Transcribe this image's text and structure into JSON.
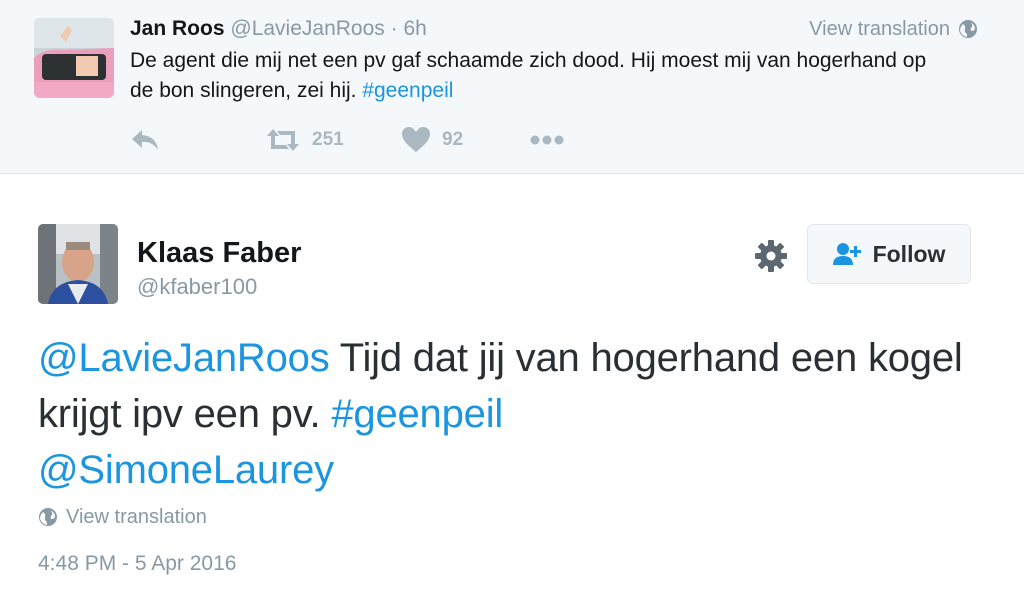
{
  "reply_tweet": {
    "name": "Jan Roos",
    "handle": "@LavieJanRoos",
    "separator": "·",
    "time": "6h",
    "view_translation": "View translation",
    "text_plain": "De agent die mij net een pv gaf schaamde zich dood. Hij moest mij van hogerhand op de bon slingeren, zei hij. ",
    "hashtag": "#geenpeil",
    "retweet_count": "251",
    "like_count": "92",
    "icons": [
      "reply-icon",
      "retweet-icon",
      "heart-icon",
      "more-icon",
      "globe-icon"
    ]
  },
  "main_tweet": {
    "name": "Klaas Faber",
    "handle": "@kfaber100",
    "follow_label": "Follow",
    "mention_1": "@LavieJanRoos",
    "text_plain": " Tijd dat jij van hogerhand een kogel krijgt ipv een pv. ",
    "hashtag": "#geenpeil",
    "mention_2": "@SimoneLaurey",
    "view_translation": "View translation",
    "timestamp": "4:48 PM - 5 Apr 2016",
    "icons": [
      "gear-icon",
      "follow-user-icon",
      "globe-icon"
    ]
  },
  "colors": {
    "link": "#1b95e0",
    "muted": "#8899a6",
    "action_icon": "#aab8c2",
    "reply_bg": "#f5f8fa"
  }
}
